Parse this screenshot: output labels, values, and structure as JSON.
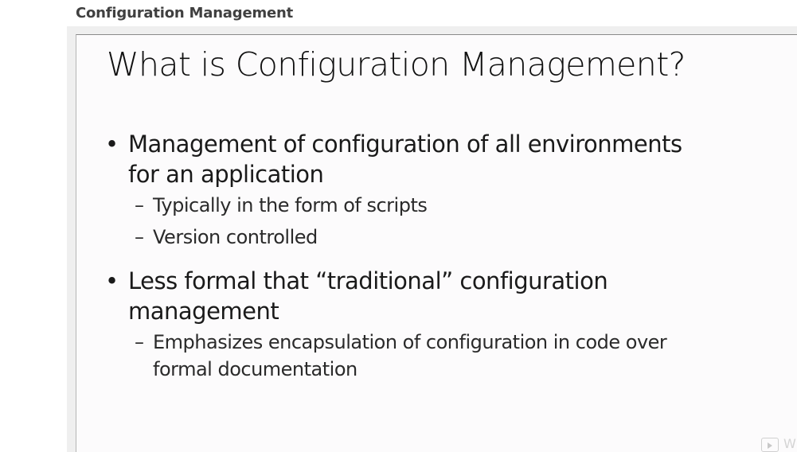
{
  "page": {
    "heading": "Configuration Management"
  },
  "slide": {
    "title": "What is Configuration Management?",
    "bullets": [
      {
        "lines": [
          "Management of configuration of all environments",
          "for an application"
        ],
        "subs": [
          {
            "lines": [
              "Typically in the form of scripts"
            ]
          },
          {
            "lines": [
              "Version controlled"
            ]
          }
        ]
      },
      {
        "lines": [
          "Less formal that “traditional” configuration",
          "management"
        ],
        "subs": [
          {
            "lines": [
              "Emphasizes encapsulation of configuration in code over",
              "formal documentation"
            ]
          }
        ]
      }
    ],
    "bullet_glyph": "•",
    "sub_glyph": "–"
  },
  "player": {
    "icon": "play-icon",
    "watermark": "W"
  }
}
